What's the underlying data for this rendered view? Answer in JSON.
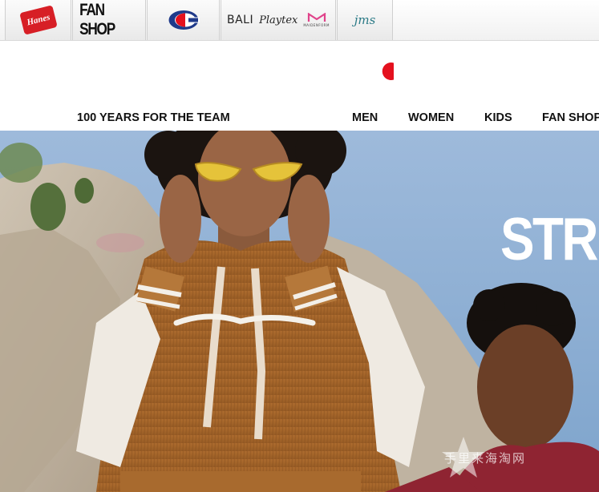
{
  "brand_bar": {
    "tabs": [
      {
        "id": "hanes",
        "label": "Hanes",
        "icon": "hanes-logo"
      },
      {
        "id": "fan-shop",
        "label": "FAN SHOP",
        "icon": "fan-shop-logo"
      },
      {
        "id": "champion",
        "label": "",
        "icon": "champion-c-logo"
      },
      {
        "id": "bali",
        "label": "BALI",
        "secondary": "Playtex",
        "tertiary": "MAIDENFORM",
        "icon": "bali-playtex-maidenform-logos"
      },
      {
        "id": "jms",
        "label": "jms",
        "icon": "jms-logo"
      }
    ]
  },
  "header": {
    "logo": "champion-logo",
    "nav": {
      "promo": "100 YEARS FOR THE TEAM",
      "items": [
        "MEN",
        "WOMEN",
        "KIDS",
        "FAN SHOP"
      ]
    }
  },
  "hero": {
    "headline": "STR",
    "watermark": "手里来海淘网"
  },
  "colors": {
    "champion_red": "#e4111e",
    "champion_blue": "#1f3a8a",
    "hanes_red": "#d71f26",
    "maidenform_pink": "#e0428a",
    "jms_teal": "#2a7a86",
    "sky_blue": "#8fb1d6"
  }
}
